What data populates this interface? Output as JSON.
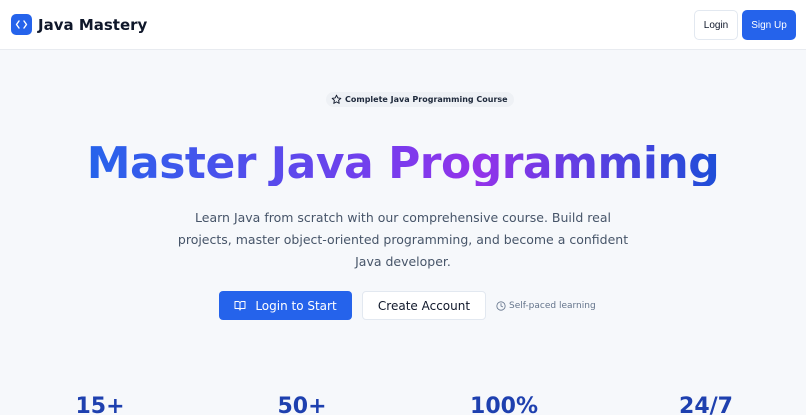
{
  "header": {
    "brand": "Java Mastery",
    "login_label": "Login",
    "signup_label": "Sign Up"
  },
  "hero": {
    "badge": "Complete Java Programming Course",
    "title": "Master Java Programming",
    "description": "Learn Java from scratch with our comprehensive course. Build real projects, master object-oriented programming, and become a confident Java developer.",
    "primary_cta": "Login to Start",
    "secondary_cta": "Create Account",
    "note": "Self-paced learning"
  },
  "stats": [
    {
      "value": "15+"
    },
    {
      "value": "50+"
    },
    {
      "value": "100%"
    },
    {
      "value": "24/7"
    }
  ],
  "icons": {
    "logo": "code-icon",
    "badge": "star-icon",
    "primary_cta": "book-open-icon",
    "note": "clock-icon"
  },
  "colors": {
    "accent": "#2563eb",
    "gradient": [
      "#2563eb",
      "#7c3aed",
      "#9333ea",
      "#1d4ed8"
    ],
    "stat_text": "#1e40af"
  }
}
